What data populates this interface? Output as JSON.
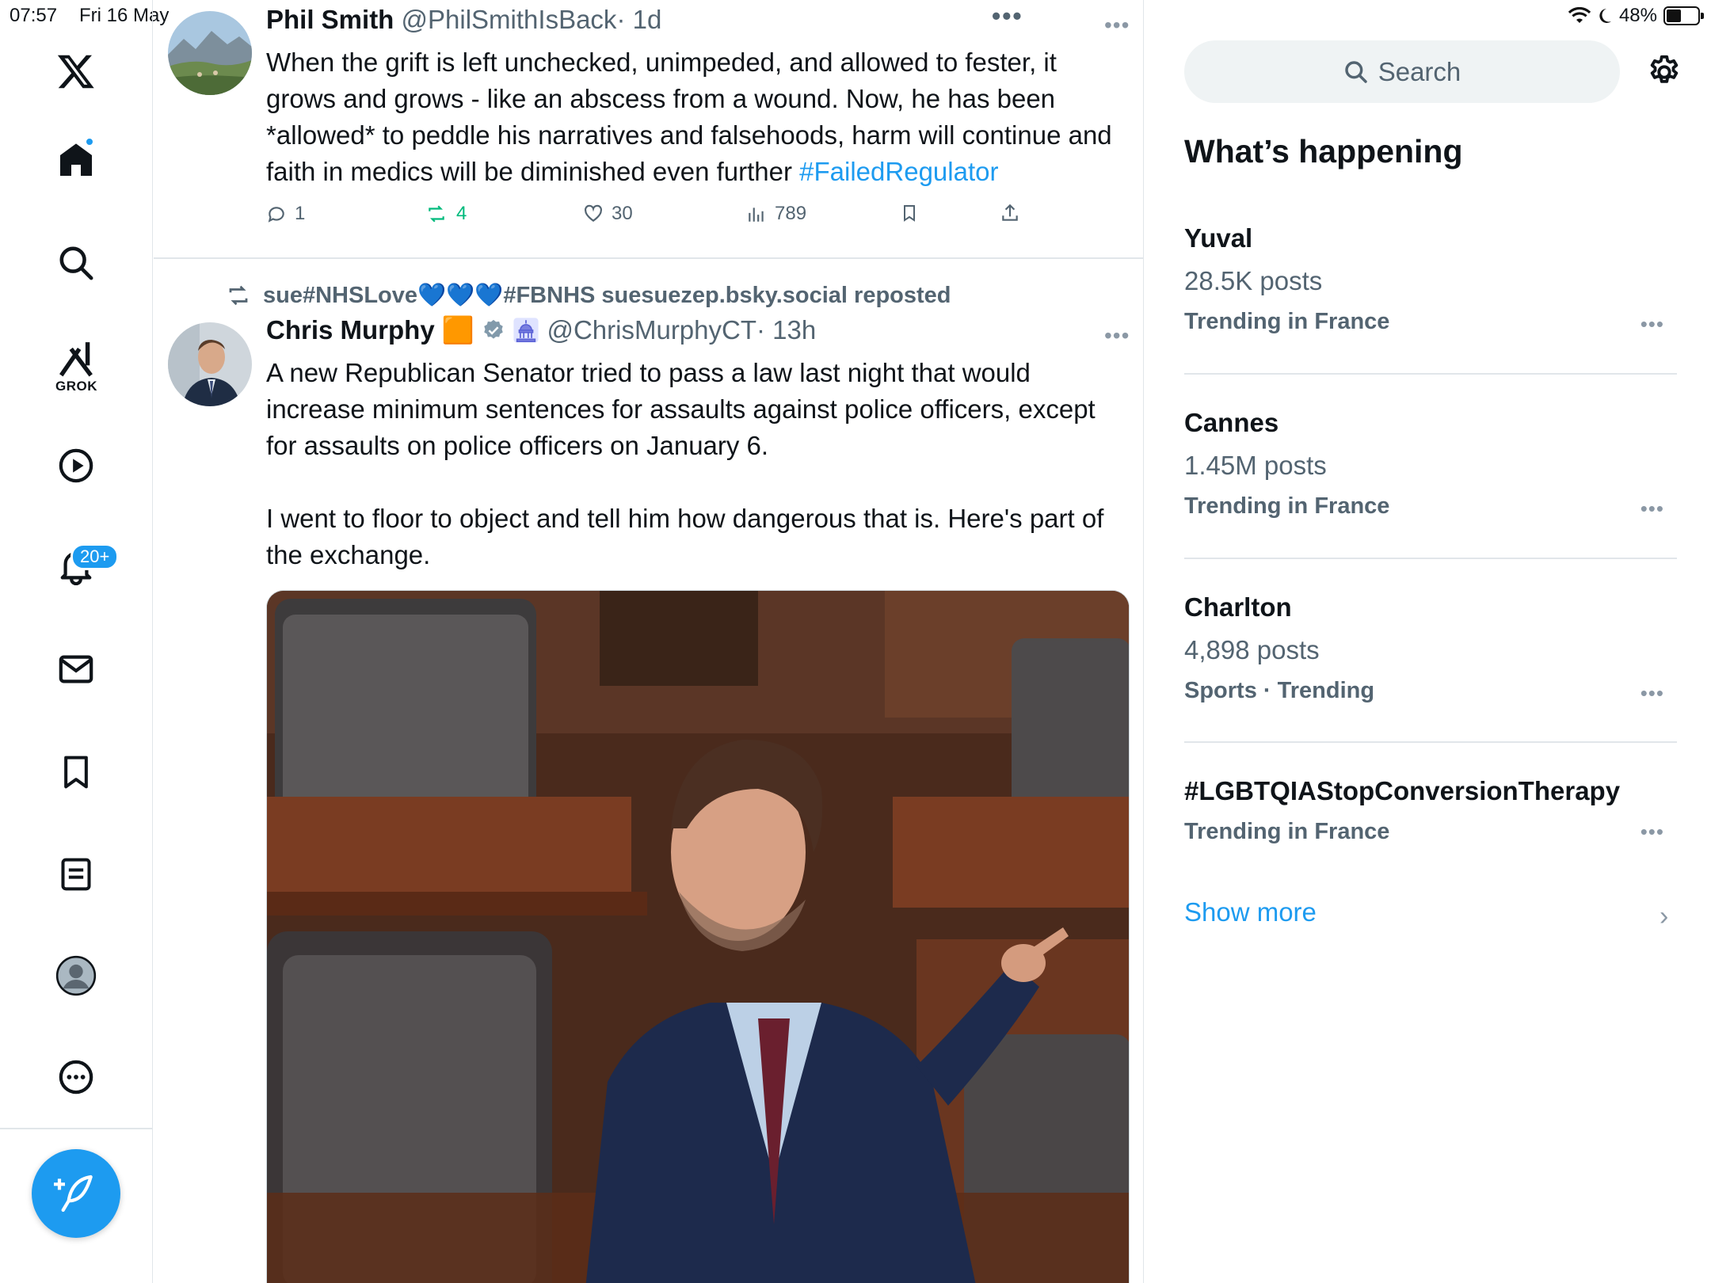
{
  "status_bar": {
    "time": "07:57",
    "date": "Fri 16 May",
    "battery": "48%",
    "battery_level": 0.48
  },
  "nav": {
    "grok_label": "GROK",
    "notifications_badge": "20+"
  },
  "top_dots": "•••",
  "tweet1": {
    "name": "Phil Smith",
    "handle": "@PhilSmithIsBack",
    "time": "· 1d",
    "text": "When the grift is left unchecked, unimpeded, and allowed to fester, it grows and grows - like an abscess from a wound. Now, he has been *allowed* to peddle his narratives and falsehoods, harm will continue and faith in medics will be diminished even further ",
    "hashtag": "#FailedRegulator",
    "replies": "1",
    "reposts": "4",
    "likes": "30",
    "views": "789",
    "more": "•••"
  },
  "tweet2": {
    "repost_by": "sue#NHSLove💙💙💙#FBNHS suesuezep.bsky.social reposted",
    "name": "Chris Murphy",
    "emoji": "🟧",
    "handle": "@ChrisMurphyCT",
    "time": "· 13h",
    "text": "A new Republican Senator tried to pass a law last night that would increase minimum sentences for assaults against police officers, except for assaults on police officers on January 6.\n\nI went to floor to object and tell him how dangerous that is. Here's part of the exchange.",
    "more": "•••"
  },
  "sidebar": {
    "search_placeholder": "Search",
    "heading": "What’s happening",
    "trends": [
      {
        "title": "Yuval",
        "count": "28.5K posts",
        "context": "Trending in France"
      },
      {
        "title": "Cannes",
        "count": "1.45M posts",
        "context": "Trending in France"
      },
      {
        "title": "Charlton",
        "count": "4,898 posts",
        "context": "Sports · Trending"
      },
      {
        "title": "#LGBTQIAStopConversionTherapy",
        "context": "Trending in France"
      }
    ],
    "trend_more": "•••",
    "show_more": "Show more"
  },
  "colors": {
    "accent": "#1d9bf0",
    "repost_green": "#00ba7c",
    "muted_text": "#536471"
  }
}
